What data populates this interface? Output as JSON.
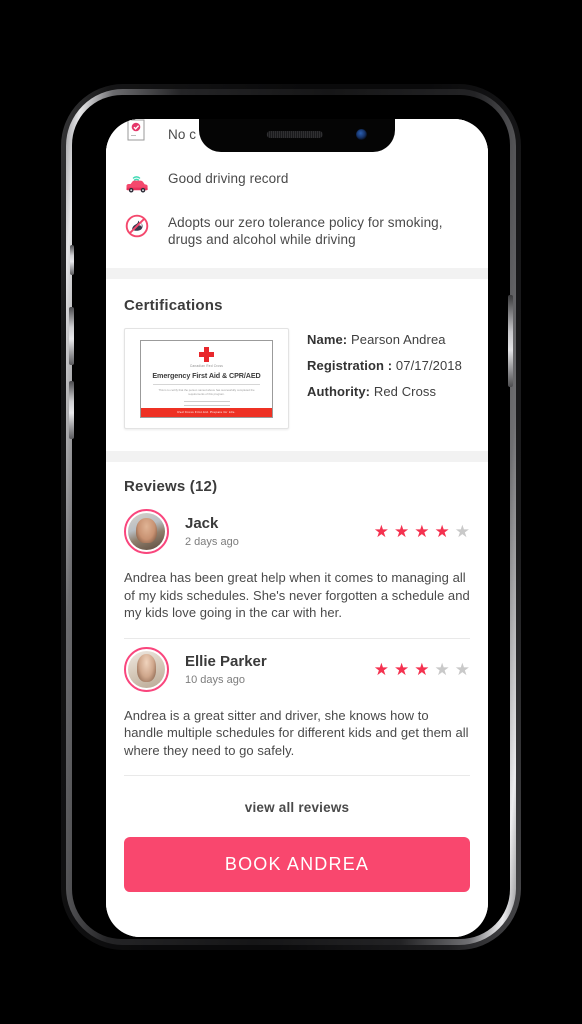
{
  "app": {
    "features": [
      {
        "icon": "document-check-icon",
        "text": "No c",
        "clipped": true
      },
      {
        "icon": "car-signal-icon",
        "text": "Good driving record",
        "clipped": false
      },
      {
        "icon": "no-smoking-icon",
        "text": "Adopts our zero tolerance policy for smoking, drugs and alcohol while driving",
        "clipped": false
      }
    ],
    "certifications": {
      "title": "Certifications",
      "thumbnail": {
        "org": "Canadian Red Cross",
        "name": "Emergency First Aid & CPR/AED",
        "body": "This is to certify that the person named above has successfully completed the requirements of this program.",
        "footer": "Red Cross First Aid. Prepare for Life."
      },
      "fields": [
        {
          "label": "Name:",
          "value": "Pearson Andrea"
        },
        {
          "label": "Registration :",
          "value": "07/17/2018"
        },
        {
          "label": "Authority:",
          "value": "Red Cross"
        }
      ]
    },
    "reviews": {
      "title": "Reviews (12)",
      "items": [
        {
          "name": "Jack",
          "when": "2 days ago",
          "rating": 4,
          "max_rating": 5,
          "body": "Andrea has been great help when it comes to managing all of my kids schedules. She's never forgotten a schedule and my kids love going in the car with her."
        },
        {
          "name": "Ellie Parker",
          "when": "10 days ago",
          "rating": 3,
          "max_rating": 5,
          "body": "Andrea is a great sitter and driver, she knows how to handle multiple schedules for different kids and get them all where they need to go safely."
        }
      ],
      "view_all_label": "view all reviews"
    },
    "cta": {
      "label": "BOOK ANDREA"
    },
    "colors": {
      "accent": "#f9476e",
      "star_on": "#f4314f",
      "star_off": "#c9c9c9",
      "cert_red": "#ee3124",
      "section_gap": "#f2f2f2"
    }
  }
}
